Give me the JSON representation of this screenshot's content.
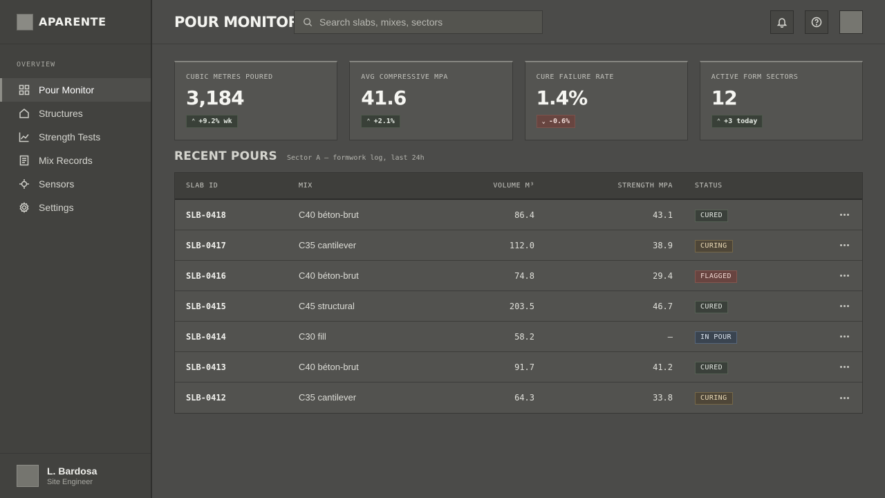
{
  "brand": {
    "name": "APARENTE"
  },
  "sidebar": {
    "section_label": "OVERVIEW",
    "items": [
      {
        "label": "Pour Monitor",
        "icon": "grid-icon",
        "active": true
      },
      {
        "label": "Structures",
        "icon": "home-icon",
        "active": false
      },
      {
        "label": "Strength Tests",
        "icon": "chart-line-icon",
        "active": false
      },
      {
        "label": "Mix Records",
        "icon": "document-icon",
        "active": false
      },
      {
        "label": "Sensors",
        "icon": "crosshair-icon",
        "active": false
      },
      {
        "label": "Settings",
        "icon": "gear-icon",
        "active": false
      }
    ],
    "user": {
      "name": "L. Bardosa",
      "role": "Site Engineer"
    }
  },
  "header": {
    "title": "POUR MONITOR",
    "search_placeholder": "Search slabs, mixes, sectors"
  },
  "kpis": [
    {
      "label": "Cubic metres poured",
      "value": "3,184",
      "delta": "+9.2% wk",
      "direction": "up"
    },
    {
      "label": "Avg compressive MPa",
      "value": "41.6",
      "delta": "+2.1%",
      "direction": "up"
    },
    {
      "label": "Cure failure rate",
      "value": "1.4%",
      "delta": "-0.6%",
      "direction": "down"
    },
    {
      "label": "Active form sectors",
      "value": "12",
      "delta": "+3 today",
      "direction": "up"
    }
  ],
  "section": {
    "title": "RECENT POURS",
    "subtitle": "Sector A — formwork log, last 24h"
  },
  "table": {
    "headers": {
      "slab_id": "SLAB ID",
      "mix": "MIX",
      "volume": "VOLUME M³",
      "strength": "STRENGTH MPA",
      "status": "STATUS"
    },
    "rows": [
      {
        "slab_id": "SLB-0418",
        "mix": "C40 béton-brut",
        "volume": "86.4",
        "strength": "43.1",
        "status": "CURED"
      },
      {
        "slab_id": "SLB-0417",
        "mix": "C35 cantilever",
        "volume": "112.0",
        "strength": "38.9",
        "status": "CURING"
      },
      {
        "slab_id": "SLB-0416",
        "mix": "C40 béton-brut",
        "volume": "74.8",
        "strength": "29.4",
        "status": "FLAGGED"
      },
      {
        "slab_id": "SLB-0415",
        "mix": "C45 structural",
        "volume": "203.5",
        "strength": "46.7",
        "status": "CURED"
      },
      {
        "slab_id": "SLB-0414",
        "mix": "C30 fill",
        "volume": "58.2",
        "strength": "—",
        "status": "IN POUR"
      },
      {
        "slab_id": "SLB-0413",
        "mix": "C40 béton-brut",
        "volume": "91.7",
        "strength": "41.2",
        "status": "CURED"
      },
      {
        "slab_id": "SLB-0412",
        "mix": "C35 cantilever",
        "volume": "64.3",
        "strength": "33.8",
        "status": "CURING"
      }
    ]
  },
  "colors": {
    "background": "#4b4b49",
    "sidebar": "#42423f",
    "cured": "#3a403a",
    "curing": "#4e4638",
    "flagged": "#684440",
    "in_pour": "#3a4450"
  }
}
